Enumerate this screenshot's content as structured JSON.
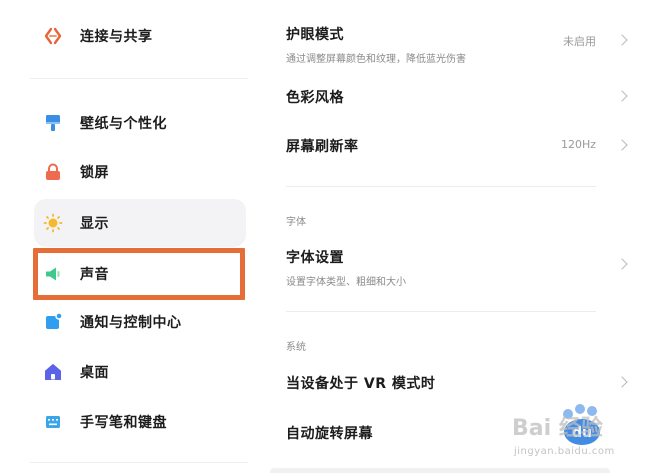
{
  "sidebar": {
    "items": [
      {
        "label": "连接与共享",
        "icon": "share-icon"
      },
      {
        "label": "壁纸与个性化",
        "icon": "brush-icon"
      },
      {
        "label": "锁屏",
        "icon": "lock-icon"
      },
      {
        "label": "显示",
        "icon": "sun-icon"
      },
      {
        "label": "声音",
        "icon": "speaker-icon"
      },
      {
        "label": "通知与控制中心",
        "icon": "notification-icon"
      },
      {
        "label": "桌面",
        "icon": "home-icon"
      },
      {
        "label": "手写笔和键盘",
        "icon": "keyboard-icon"
      }
    ],
    "active_item": "显示",
    "highlighted_item": "声音"
  },
  "main": {
    "eye_protection": {
      "title": "护眼模式",
      "subtitle": "通过调整屏幕颜色和纹理，降低蓝光伤害",
      "value": "未启用"
    },
    "color_style": {
      "title": "色彩风格"
    },
    "refresh_rate": {
      "title": "屏幕刷新率",
      "value": "120Hz"
    },
    "font_section": {
      "label": "字体"
    },
    "font_settings": {
      "title": "字体设置",
      "subtitle": "设置字体类型、粗细和大小"
    },
    "system_section": {
      "label": "系统"
    },
    "vr_mode": {
      "title": "当设备处于 VR 模式时"
    },
    "auto_rotate": {
      "title": "自动旋转屏幕"
    }
  },
  "watermark": {
    "text": "Bai 经验",
    "sub": "jingyan.baidu.com"
  },
  "colors": {
    "highlight": "#e66d38",
    "share": "#e8643c",
    "brush": "#3a8ee6",
    "lock": "#ef6b4f",
    "sun": "#f5b82e",
    "speaker": "#3fc98a",
    "notification": "#2f9df0",
    "home": "#5b63e6",
    "keyboard": "#3aa5e8"
  }
}
